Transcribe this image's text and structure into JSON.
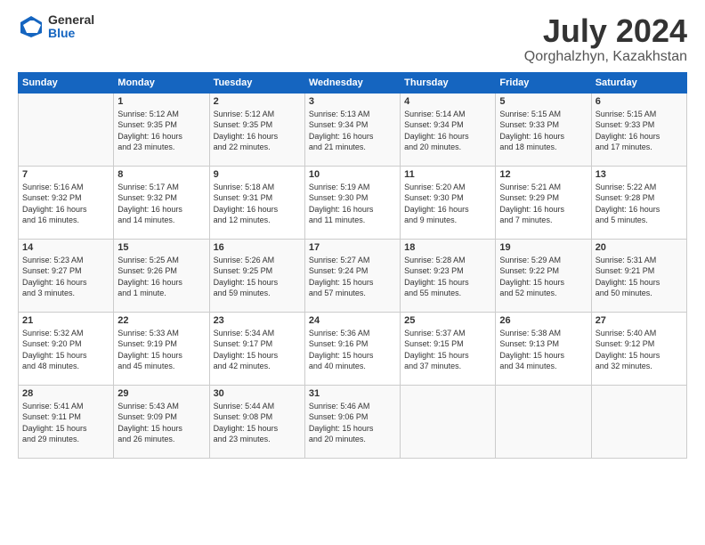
{
  "header": {
    "logo_general": "General",
    "logo_blue": "Blue",
    "month_title": "July 2024",
    "location": "Qorghalzhyn, Kazakhstan"
  },
  "days_of_week": [
    "Sunday",
    "Monday",
    "Tuesday",
    "Wednesday",
    "Thursday",
    "Friday",
    "Saturday"
  ],
  "weeks": [
    [
      {
        "day": "",
        "info": ""
      },
      {
        "day": "1",
        "info": "Sunrise: 5:12 AM\nSunset: 9:35 PM\nDaylight: 16 hours\nand 23 minutes."
      },
      {
        "day": "2",
        "info": "Sunrise: 5:12 AM\nSunset: 9:35 PM\nDaylight: 16 hours\nand 22 minutes."
      },
      {
        "day": "3",
        "info": "Sunrise: 5:13 AM\nSunset: 9:34 PM\nDaylight: 16 hours\nand 21 minutes."
      },
      {
        "day": "4",
        "info": "Sunrise: 5:14 AM\nSunset: 9:34 PM\nDaylight: 16 hours\nand 20 minutes."
      },
      {
        "day": "5",
        "info": "Sunrise: 5:15 AM\nSunset: 9:33 PM\nDaylight: 16 hours\nand 18 minutes."
      },
      {
        "day": "6",
        "info": "Sunrise: 5:15 AM\nSunset: 9:33 PM\nDaylight: 16 hours\nand 17 minutes."
      }
    ],
    [
      {
        "day": "7",
        "info": "Sunrise: 5:16 AM\nSunset: 9:32 PM\nDaylight: 16 hours\nand 16 minutes."
      },
      {
        "day": "8",
        "info": "Sunrise: 5:17 AM\nSunset: 9:32 PM\nDaylight: 16 hours\nand 14 minutes."
      },
      {
        "day": "9",
        "info": "Sunrise: 5:18 AM\nSunset: 9:31 PM\nDaylight: 16 hours\nand 12 minutes."
      },
      {
        "day": "10",
        "info": "Sunrise: 5:19 AM\nSunset: 9:30 PM\nDaylight: 16 hours\nand 11 minutes."
      },
      {
        "day": "11",
        "info": "Sunrise: 5:20 AM\nSunset: 9:30 PM\nDaylight: 16 hours\nand 9 minutes."
      },
      {
        "day": "12",
        "info": "Sunrise: 5:21 AM\nSunset: 9:29 PM\nDaylight: 16 hours\nand 7 minutes."
      },
      {
        "day": "13",
        "info": "Sunrise: 5:22 AM\nSunset: 9:28 PM\nDaylight: 16 hours\nand 5 minutes."
      }
    ],
    [
      {
        "day": "14",
        "info": "Sunrise: 5:23 AM\nSunset: 9:27 PM\nDaylight: 16 hours\nand 3 minutes."
      },
      {
        "day": "15",
        "info": "Sunrise: 5:25 AM\nSunset: 9:26 PM\nDaylight: 16 hours\nand 1 minute."
      },
      {
        "day": "16",
        "info": "Sunrise: 5:26 AM\nSunset: 9:25 PM\nDaylight: 15 hours\nand 59 minutes."
      },
      {
        "day": "17",
        "info": "Sunrise: 5:27 AM\nSunset: 9:24 PM\nDaylight: 15 hours\nand 57 minutes."
      },
      {
        "day": "18",
        "info": "Sunrise: 5:28 AM\nSunset: 9:23 PM\nDaylight: 15 hours\nand 55 minutes."
      },
      {
        "day": "19",
        "info": "Sunrise: 5:29 AM\nSunset: 9:22 PM\nDaylight: 15 hours\nand 52 minutes."
      },
      {
        "day": "20",
        "info": "Sunrise: 5:31 AM\nSunset: 9:21 PM\nDaylight: 15 hours\nand 50 minutes."
      }
    ],
    [
      {
        "day": "21",
        "info": "Sunrise: 5:32 AM\nSunset: 9:20 PM\nDaylight: 15 hours\nand 48 minutes."
      },
      {
        "day": "22",
        "info": "Sunrise: 5:33 AM\nSunset: 9:19 PM\nDaylight: 15 hours\nand 45 minutes."
      },
      {
        "day": "23",
        "info": "Sunrise: 5:34 AM\nSunset: 9:17 PM\nDaylight: 15 hours\nand 42 minutes."
      },
      {
        "day": "24",
        "info": "Sunrise: 5:36 AM\nSunset: 9:16 PM\nDaylight: 15 hours\nand 40 minutes."
      },
      {
        "day": "25",
        "info": "Sunrise: 5:37 AM\nSunset: 9:15 PM\nDaylight: 15 hours\nand 37 minutes."
      },
      {
        "day": "26",
        "info": "Sunrise: 5:38 AM\nSunset: 9:13 PM\nDaylight: 15 hours\nand 34 minutes."
      },
      {
        "day": "27",
        "info": "Sunrise: 5:40 AM\nSunset: 9:12 PM\nDaylight: 15 hours\nand 32 minutes."
      }
    ],
    [
      {
        "day": "28",
        "info": "Sunrise: 5:41 AM\nSunset: 9:11 PM\nDaylight: 15 hours\nand 29 minutes."
      },
      {
        "day": "29",
        "info": "Sunrise: 5:43 AM\nSunset: 9:09 PM\nDaylight: 15 hours\nand 26 minutes."
      },
      {
        "day": "30",
        "info": "Sunrise: 5:44 AM\nSunset: 9:08 PM\nDaylight: 15 hours\nand 23 minutes."
      },
      {
        "day": "31",
        "info": "Sunrise: 5:46 AM\nSunset: 9:06 PM\nDaylight: 15 hours\nand 20 minutes."
      },
      {
        "day": "",
        "info": ""
      },
      {
        "day": "",
        "info": ""
      },
      {
        "day": "",
        "info": ""
      }
    ]
  ]
}
